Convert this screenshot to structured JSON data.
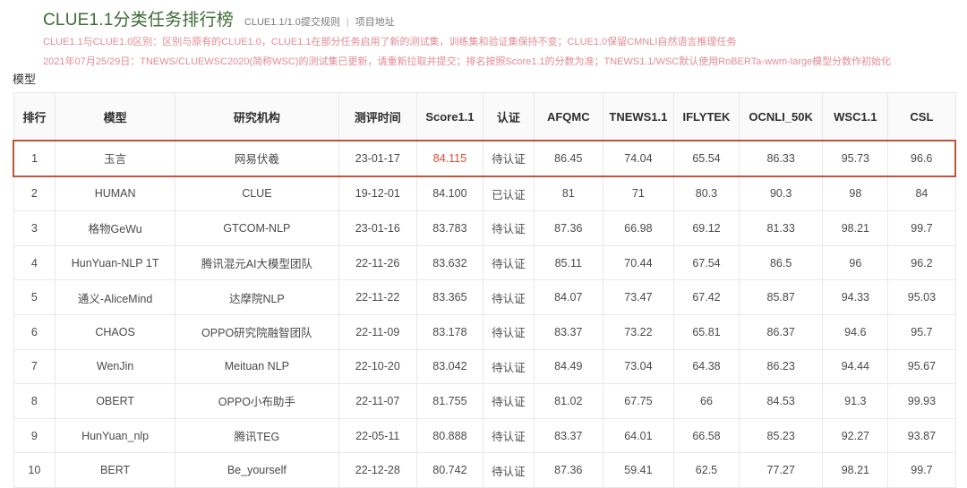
{
  "header": {
    "title": "CLUE1.1分类任务排行榜",
    "links": [
      {
        "label": "CLUE1.1/1.0提交规则"
      },
      {
        "label": "项目地址"
      }
    ],
    "separator": "|",
    "notice_line_1": "CLUE1.1与CLUE1.0区别：区别与原有的CLUE1.0，CLUE1.1在部分任务启用了新的测试集，训练集和验证集保持不变；CLUE1.0保留CMNLI自然语言推理任务",
    "notice_line_2": "2021年07月25/29日：TNEWS/CLUEWSC2020(简称WSC)的测试集已更新，请重新拉取并提交；排名按照Score1.1的分数为准；TNEWS1.1/WSC默认使用RoBERTa-wwm-large模型分数作初始化"
  },
  "side_label": "模型",
  "colors": {
    "title_green": "#3d6b35",
    "notice_red": "#e58a96",
    "highlight_border": "#c0543c",
    "top_score_red": "#e04a35",
    "model_link_blue": "#7a86b8"
  },
  "table": {
    "columns": [
      "排行",
      "模型",
      "研究机构",
      "测评时间",
      "Score1.1",
      "认证",
      "AFQMC",
      "TNEWS1.1",
      "IFLYTEK",
      "OCNLI_50K",
      "WSC1.1",
      "CSL"
    ],
    "rows": [
      {
        "rank": "1",
        "model": "玉言",
        "institution": "网易伏羲",
        "date": "23-01-17",
        "score": "84.115",
        "verify": "待认证",
        "afqmc": "86.45",
        "tnews": "74.04",
        "iflytek": "65.54",
        "ocnli": "86.33",
        "wsc": "95.73",
        "csl": "96.6",
        "highlight": true
      },
      {
        "rank": "2",
        "model": "HUMAN",
        "institution": "CLUE",
        "date": "19-12-01",
        "score": "84.100",
        "verify": "已认证",
        "afqmc": "81",
        "tnews": "71",
        "iflytek": "80.3",
        "ocnli": "90.3",
        "wsc": "98",
        "csl": "84",
        "highlight": false
      },
      {
        "rank": "3",
        "model": "格物GeWu",
        "institution": "GTCOM-NLP",
        "date": "23-01-16",
        "score": "83.783",
        "verify": "待认证",
        "afqmc": "87.36",
        "tnews": "66.98",
        "iflytek": "69.12",
        "ocnli": "81.33",
        "wsc": "98.21",
        "csl": "99.7",
        "highlight": false
      },
      {
        "rank": "4",
        "model": "HunYuan-NLP 1T",
        "institution": "腾讯混元AI大模型团队",
        "date": "22-11-26",
        "score": "83.632",
        "verify": "待认证",
        "afqmc": "85.11",
        "tnews": "70.44",
        "iflytek": "67.54",
        "ocnli": "86.5",
        "wsc": "96",
        "csl": "96.2",
        "highlight": false
      },
      {
        "rank": "5",
        "model": "通义-AliceMind",
        "institution": "达摩院NLP",
        "date": "22-11-22",
        "score": "83.365",
        "verify": "待认证",
        "afqmc": "84.07",
        "tnews": "73.47",
        "iflytek": "67.42",
        "ocnli": "85.87",
        "wsc": "94.33",
        "csl": "95.03",
        "highlight": false
      },
      {
        "rank": "6",
        "model": "CHAOS",
        "institution": "OPPO研究院融智团队",
        "date": "22-11-09",
        "score": "83.178",
        "verify": "待认证",
        "afqmc": "83.37",
        "tnews": "73.22",
        "iflytek": "65.81",
        "ocnli": "86.37",
        "wsc": "94.6",
        "csl": "95.7",
        "highlight": false
      },
      {
        "rank": "7",
        "model": "WenJin",
        "institution": "Meituan NLP",
        "date": "22-10-20",
        "score": "83.042",
        "verify": "待认证",
        "afqmc": "84.49",
        "tnews": "73.04",
        "iflytek": "64.38",
        "ocnli": "86.23",
        "wsc": "94.44",
        "csl": "95.67",
        "highlight": false
      },
      {
        "rank": "8",
        "model": "OBERT",
        "institution": "OPPO小布助手",
        "date": "22-11-07",
        "score": "81.755",
        "verify": "待认证",
        "afqmc": "81.02",
        "tnews": "67.75",
        "iflytek": "66",
        "ocnli": "84.53",
        "wsc": "91.3",
        "csl": "99.93",
        "highlight": false
      },
      {
        "rank": "9",
        "model": "HunYuan_nlp",
        "institution": "腾讯TEG",
        "date": "22-05-11",
        "score": "80.888",
        "verify": "待认证",
        "afqmc": "83.37",
        "tnews": "64.01",
        "iflytek": "66.58",
        "ocnli": "85.23",
        "wsc": "92.27",
        "csl": "93.87",
        "highlight": false
      },
      {
        "rank": "10",
        "model": "BERT",
        "institution": "Be_yourself",
        "date": "22-12-28",
        "score": "80.742",
        "verify": "待认证",
        "afqmc": "87.36",
        "tnews": "59.41",
        "iflytek": "62.5",
        "ocnli": "77.27",
        "wsc": "98.21",
        "csl": "99.7",
        "highlight": false
      }
    ]
  }
}
